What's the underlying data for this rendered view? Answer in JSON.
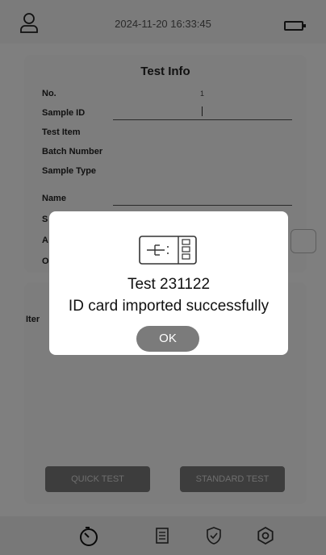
{
  "status": {
    "datetime": "2024-11-20  16:33:45"
  },
  "test_info": {
    "title": "Test Info",
    "rows": [
      {
        "label": "No.",
        "value": "1"
      },
      {
        "label": "Sample ID",
        "value": ""
      },
      {
        "label": "Test Item",
        "value": ""
      },
      {
        "label": "Batch Number",
        "value": ""
      },
      {
        "label": "Sample Type",
        "value": ""
      },
      {
        "label": "Name",
        "value": ""
      },
      {
        "label": "S",
        "value": ""
      },
      {
        "label": "A",
        "value": ""
      },
      {
        "label": "O",
        "value": ""
      }
    ]
  },
  "items": {
    "label": "Iter"
  },
  "buttons": {
    "quick": "QUICK TEST",
    "standard": "STANDARD TEST"
  },
  "dialog": {
    "line1": "Test 231122",
    "line2": "ID card imported successfully",
    "ok": "OK"
  },
  "nav": [
    "timer-icon",
    "list-icon",
    "shield-icon",
    "settings-icon"
  ]
}
